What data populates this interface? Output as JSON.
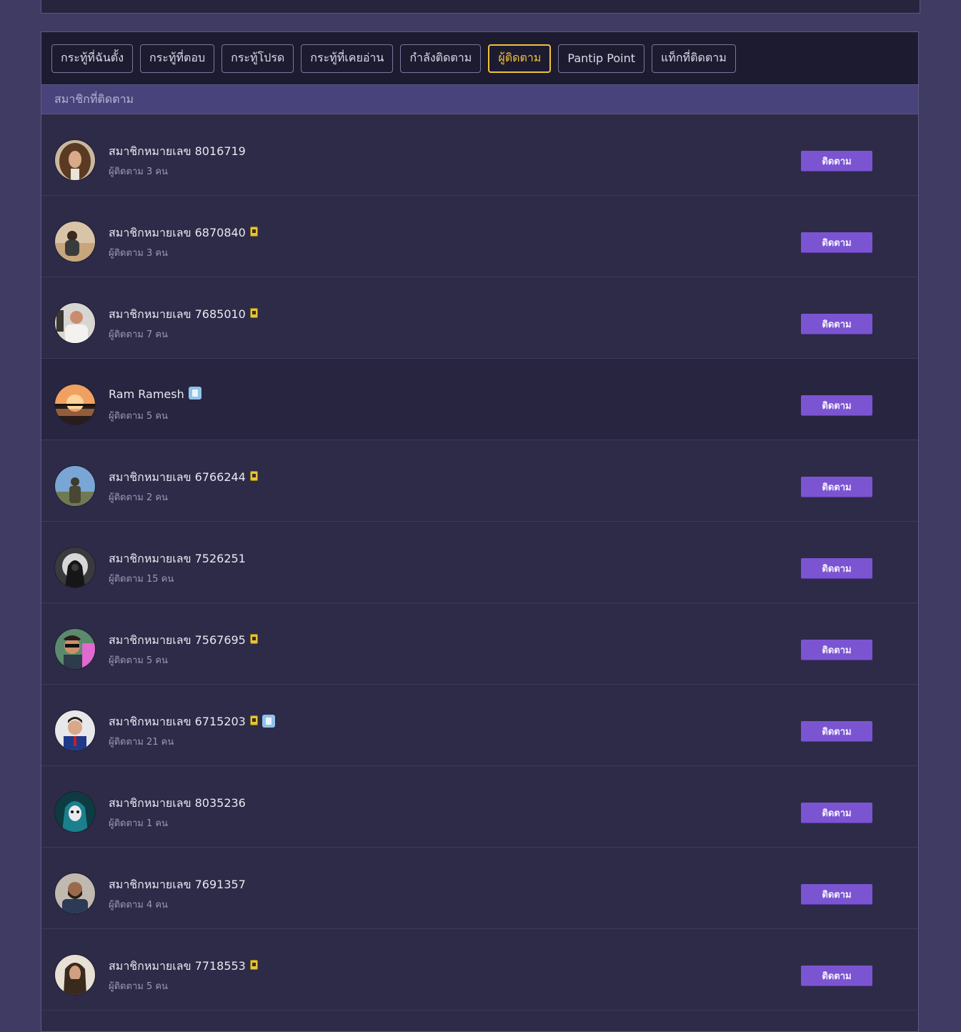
{
  "tabs": [
    {
      "label": "กระทู้ที่ฉันตั้ง",
      "active": false
    },
    {
      "label": "กระทู้ที่ตอบ",
      "active": false
    },
    {
      "label": "กระทู้โปรด",
      "active": false
    },
    {
      "label": "กระทู้ที่เคยอ่าน",
      "active": false
    },
    {
      "label": "กำลังติดตาม",
      "active": false
    },
    {
      "label": "ผู้ติดตาม",
      "active": true
    },
    {
      "label": "Pantip Point",
      "active": false
    },
    {
      "label": "แท็กที่ติดตาม",
      "active": false
    }
  ],
  "section_title": "สมาชิกที่ติดตาม",
  "follow_label": "ติดตาม",
  "members": [
    {
      "name": "สมาชิกหมายเลข 8016719",
      "followers": "ผู้ติดตาม 3 คน",
      "badges": [],
      "avatar": "avatar-curly-hair"
    },
    {
      "name": "สมาชิกหมายเลข 6870840",
      "followers": "ผู้ติดตาม 3 คน",
      "badges": [
        "yellow-id-badge"
      ],
      "avatar": "avatar-person-beach"
    },
    {
      "name": "สมาชิกหมายเลข 7685010",
      "followers": "ผู้ติดตาม 7 คน",
      "badges": [
        "yellow-id-badge"
      ],
      "avatar": "avatar-man-white-shirt"
    },
    {
      "name": "Ram Ramesh",
      "followers": "ผู้ติดตาม 5 คน",
      "badges": [
        "blue-id-badge"
      ],
      "avatar": "avatar-sunset"
    },
    {
      "name": "สมาชิกหมายเลข 6766244",
      "followers": "ผู้ติดตาม 2 คน",
      "badges": [
        "yellow-id-badge"
      ],
      "avatar": "avatar-soldier-sky"
    },
    {
      "name": "สมาชิกหมายเลข 7526251",
      "followers": "ผู้ติดตาม 15 คน",
      "badges": [],
      "avatar": "avatar-hooded-figure"
    },
    {
      "name": "สมาชิกหมายเลข 7567695",
      "followers": "ผู้ติดตาม 5 คน",
      "badges": [
        "yellow-id-badge"
      ],
      "avatar": "avatar-sunglasses-man"
    },
    {
      "name": "สมาชิกหมายเลข 6715203",
      "followers": "ผู้ติดตาม 21 คน",
      "badges": [
        "yellow-id-badge",
        "blue-id-badge"
      ],
      "avatar": "avatar-man-suit"
    },
    {
      "name": "สมาชิกหมายเลข 8035236",
      "followers": "ผู้ติดตาม 1 คน",
      "badges": [],
      "avatar": "avatar-mask-teal"
    },
    {
      "name": "สมาชิกหมายเลข 7691357",
      "followers": "ผู้ติดตาม 4 คน",
      "badges": [],
      "avatar": "avatar-bearded-man"
    },
    {
      "name": "สมาชิกหมายเลข 7718553",
      "followers": "ผู้ติดตาม 5 คน",
      "badges": [
        "yellow-id-badge"
      ],
      "avatar": "avatar-long-hair-man"
    }
  ]
}
